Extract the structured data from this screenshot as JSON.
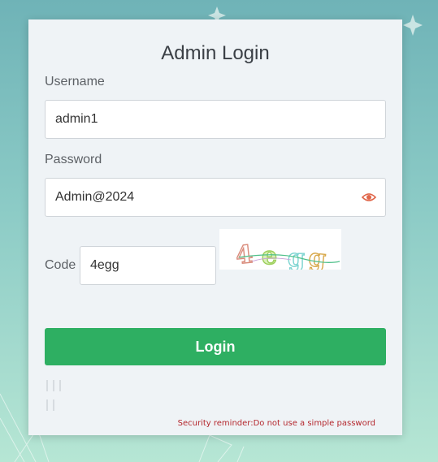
{
  "login": {
    "title": "Admin Login",
    "username_label": "Username",
    "username_value": "admin1",
    "password_label": "Password",
    "password_value": "Admin@2024",
    "code_label": "Code",
    "code_value": "4egg",
    "captcha_text": "4egg",
    "login_button": "Login",
    "security_reminder": "Security reminder:Do not use a simple password"
  },
  "icons": {
    "password_toggle": "eye-icon"
  },
  "colors": {
    "primary_button": "#2eaf62",
    "reminder_text": "#b4272d",
    "eye_icon": "#e0664a"
  }
}
